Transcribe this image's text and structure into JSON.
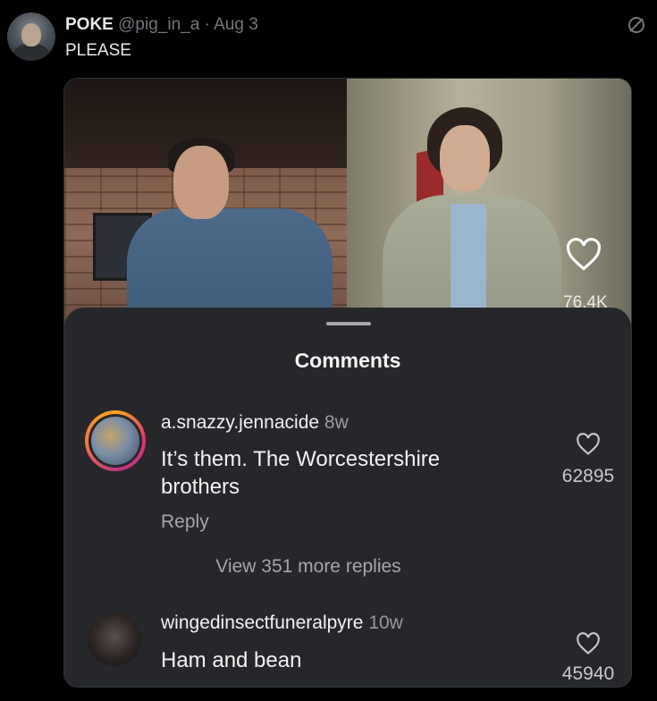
{
  "tweet": {
    "display_name": "POKE",
    "handle": "@pig_in_a",
    "separator": "·",
    "date": "Aug 3",
    "text": "PLEASE",
    "mute_icon": "mute-icon"
  },
  "video": {
    "like_count": "76.4K",
    "like_icon": "heart-outline-icon"
  },
  "comments_sheet": {
    "title": "Comments",
    "comments": [
      {
        "username": "a.snazzy.jennacide",
        "time": "8w",
        "text_line1": "It’s them. The Worcestershire",
        "text_line2": "brothers",
        "reply_label": "Reply",
        "view_replies_label": "View 351 more replies",
        "likes": "62895",
        "has_story_ring": true
      },
      {
        "username": "wingedinsectfuneralpyre",
        "time": "10w",
        "text_line1": "Ham and bean",
        "likes": "45940",
        "has_story_ring": false
      }
    ]
  },
  "colors": {
    "background": "#000000",
    "sheet": "#26272b",
    "secondary_text": "#71767b"
  }
}
